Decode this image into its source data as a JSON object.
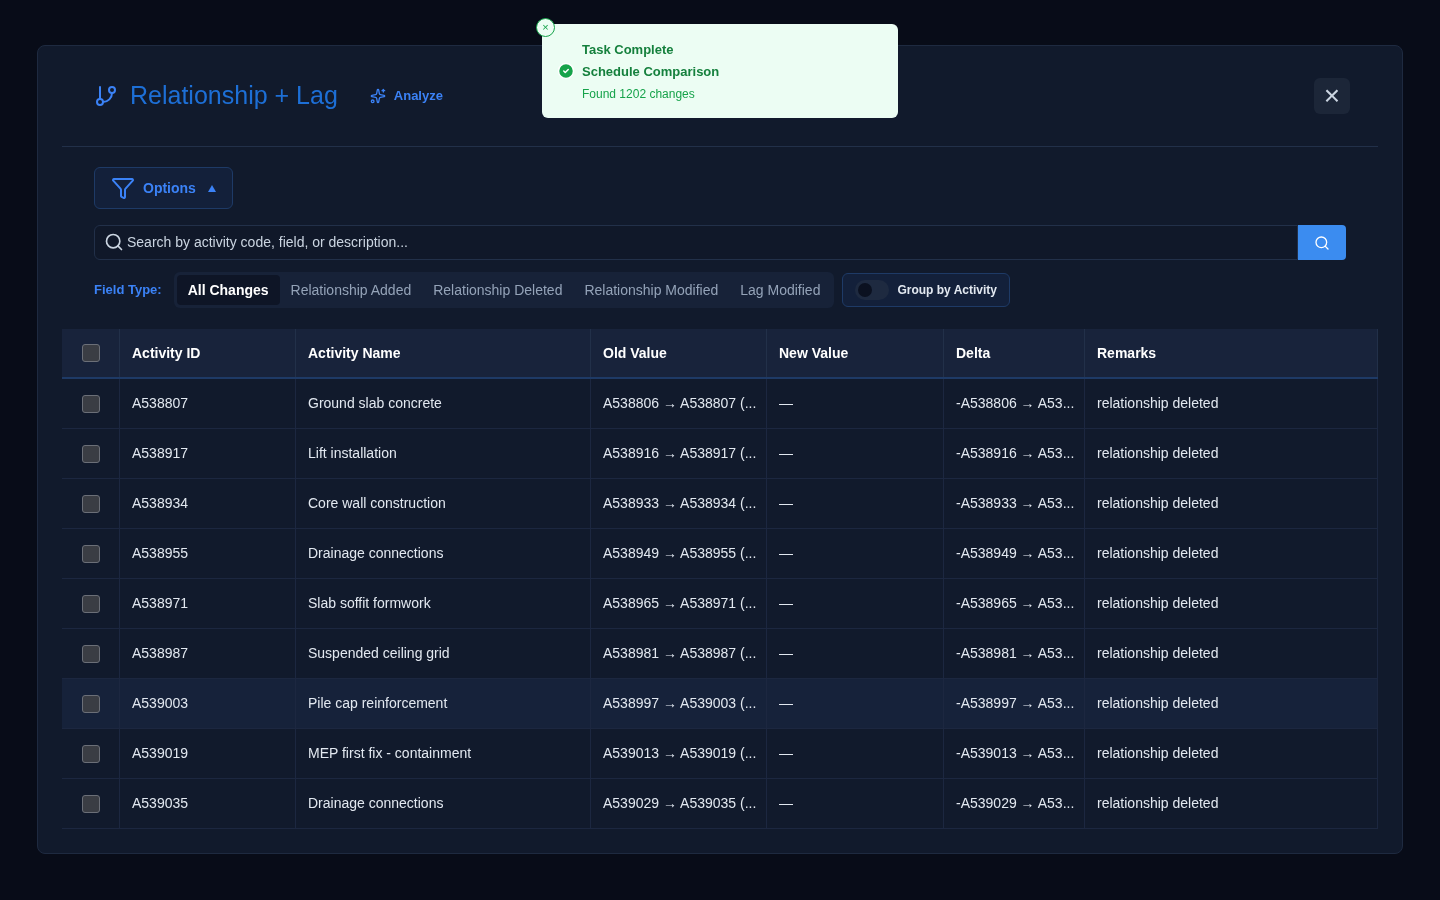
{
  "toast": {
    "title": "Task Complete",
    "heading": "Schedule Comparison",
    "message": "Found 1202 changes",
    "close": "×"
  },
  "modal": {
    "title": "Relationship + Lag",
    "analyze": "Analyze",
    "close": "×"
  },
  "options_button": {
    "label": "Options",
    "expanded": true
  },
  "search": {
    "placeholder": "Search by activity code, field, or description..."
  },
  "field_type": {
    "label": "Field Type:",
    "tabs": [
      {
        "label": "All Changes",
        "selected": true
      },
      {
        "label": "Relationship Added",
        "selected": false
      },
      {
        "label": "Relationship Deleted",
        "selected": false
      },
      {
        "label": "Relationship Modified",
        "selected": false
      },
      {
        "label": "Lag Modified",
        "selected": false
      }
    ]
  },
  "group_toggle": {
    "label": "Group by Activity",
    "on": false
  },
  "table": {
    "select_all": {
      "checked": false
    },
    "columns": [
      "Activity ID",
      "Activity Name",
      "Old Value",
      "New Value",
      "Delta",
      "Remarks"
    ],
    "rows": [
      {
        "checked": false,
        "hovered": false,
        "cells": [
          "A538807",
          "Ground slab concrete",
          "A538806 → A538807 (...",
          "—",
          "-A538806 → A53...",
          "relationship deleted"
        ]
      },
      {
        "checked": false,
        "hovered": false,
        "cells": [
          "A538917",
          "Lift installation",
          "A538916 → A538917 (...",
          "—",
          "-A538916 → A53...",
          "relationship deleted"
        ]
      },
      {
        "checked": false,
        "hovered": false,
        "cells": [
          "A538934",
          "Core wall construction",
          "A538933 → A538934 (...",
          "—",
          "-A538933 → A53...",
          "relationship deleted"
        ]
      },
      {
        "checked": false,
        "hovered": false,
        "cells": [
          "A538955",
          "Drainage connections",
          "A538949 → A538955 (...",
          "—",
          "-A538949 → A53...",
          "relationship deleted"
        ]
      },
      {
        "checked": false,
        "hovered": false,
        "cells": [
          "A538971",
          "Slab soffit formwork",
          "A538965 → A538971 (...",
          "—",
          "-A538965 → A53...",
          "relationship deleted"
        ]
      },
      {
        "checked": false,
        "hovered": false,
        "cells": [
          "A538987",
          "Suspended ceiling grid",
          "A538981 → A538987 (...",
          "—",
          "-A538981 → A53...",
          "relationship deleted"
        ]
      },
      {
        "checked": false,
        "hovered": true,
        "cells": [
          "A539003",
          "Pile cap reinforcement",
          "A538997 → A539003 (...",
          "—",
          "-A538997 → A53...",
          "relationship deleted"
        ]
      },
      {
        "checked": false,
        "hovered": false,
        "cells": [
          "A539019",
          "MEP first fix - containment",
          "A539013 → A539019 (...",
          "—",
          "-A539013 → A53...",
          "relationship deleted"
        ]
      },
      {
        "checked": false,
        "hovered": false,
        "cells": [
          "A539035",
          "Drainage connections",
          "A539029 → A539035 (...",
          "—",
          "-A539029 → A53...",
          "relationship deleted"
        ]
      }
    ]
  }
}
